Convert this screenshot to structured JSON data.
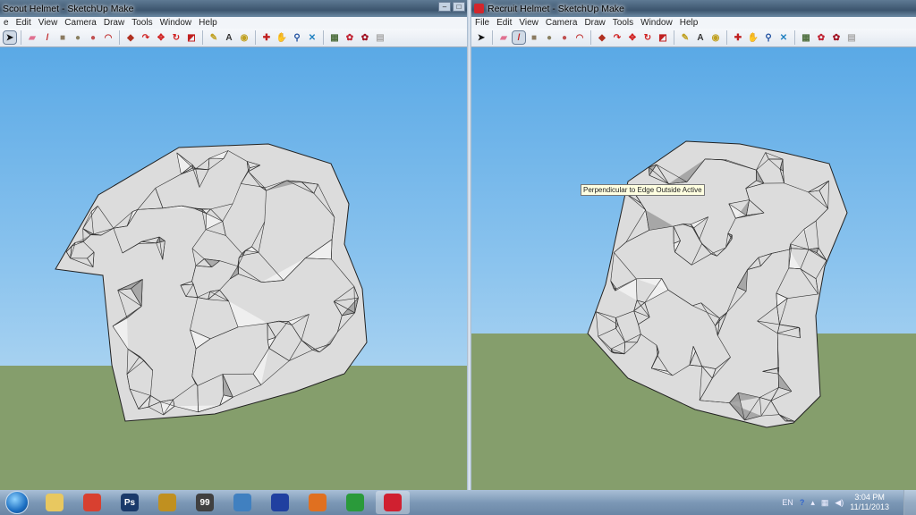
{
  "left_window": {
    "title": "Scout Helmet - SketchUp Make",
    "menu": [
      "e",
      "Edit",
      "View",
      "Camera",
      "Draw",
      "Tools",
      "Window",
      "Help"
    ],
    "selected_tool": "select"
  },
  "right_window": {
    "title": "Recruit Helmet - SketchUp Make",
    "menu": [
      "File",
      "Edit",
      "View",
      "Camera",
      "Draw",
      "Tools",
      "Window",
      "Help"
    ],
    "selected_tool": "pencil",
    "tooltip": "Perpendicular to Edge Outside Active"
  },
  "toolbar": [
    {
      "icon": "select-icon",
      "g": "➤",
      "c": "#111"
    },
    {
      "sep": true
    },
    {
      "icon": "eraser-icon",
      "g": "▰",
      "c": "#e07090"
    },
    {
      "icon": "pencil-icon",
      "g": "/",
      "c": "#c02020"
    },
    {
      "icon": "rectangle-icon",
      "g": "■",
      "c": "#8a7a60"
    },
    {
      "icon": "circle-icon",
      "g": "●",
      "c": "#8a8060"
    },
    {
      "icon": "polygon-icon",
      "g": "●",
      "c": "#c05050"
    },
    {
      "icon": "arc-icon",
      "g": "◠",
      "c": "#c03030"
    },
    {
      "sep": true
    },
    {
      "icon": "push-pull-icon",
      "g": "◆",
      "c": "#b03020"
    },
    {
      "icon": "follow-me-icon",
      "g": "↷",
      "c": "#d02020"
    },
    {
      "icon": "move-icon",
      "g": "✥",
      "c": "#d02020"
    },
    {
      "icon": "rotate-icon",
      "g": "↻",
      "c": "#d02020"
    },
    {
      "icon": "scale-icon",
      "g": "◩",
      "c": "#c02020"
    },
    {
      "sep": true
    },
    {
      "icon": "tape-measure-icon",
      "g": "✎",
      "c": "#c0a020"
    },
    {
      "icon": "text-icon",
      "g": "A",
      "c": "#333"
    },
    {
      "icon": "paint-bucket-icon",
      "g": "◉",
      "c": "#c0a020"
    },
    {
      "sep": true
    },
    {
      "icon": "orbit-icon",
      "g": "✚",
      "c": "#c02020"
    },
    {
      "icon": "pan-icon",
      "g": "✋",
      "c": "#888"
    },
    {
      "icon": "zoom-icon",
      "g": "⚲",
      "c": "#2050a0"
    },
    {
      "icon": "zoom-extents-icon",
      "g": "✕",
      "c": "#2080c0"
    },
    {
      "sep": true
    },
    {
      "icon": "get-models-icon",
      "g": "▦",
      "c": "#507040"
    },
    {
      "icon": "share-model-icon",
      "g": "✿",
      "c": "#c02030"
    },
    {
      "icon": "extension-warehouse-icon",
      "g": "✿",
      "c": "#a01020"
    },
    {
      "icon": "layout-icon",
      "g": "▤",
      "c": "#aaa"
    }
  ],
  "taskbar": {
    "items": [
      {
        "icon": "explorer-icon",
        "label": "",
        "c": "#e8c860"
      },
      {
        "icon": "chrome-icon",
        "label": "",
        "c": "#d84030"
      },
      {
        "icon": "photoshop-icon",
        "label": "Ps",
        "c": "#1a3a6a"
      },
      {
        "icon": "fl-studio-icon",
        "label": "",
        "c": "#c09020"
      },
      {
        "icon": "fraps-icon",
        "label": "99",
        "c": "#404040"
      },
      {
        "icon": "sketchup-app-icon",
        "label": "",
        "c": "#4080c0"
      },
      {
        "icon": "audacity-icon",
        "label": "",
        "c": "#2040a0"
      },
      {
        "icon": "blender-icon",
        "label": "",
        "c": "#e07020"
      },
      {
        "icon": "utorrent-icon",
        "label": "",
        "c": "#2a9a3a"
      },
      {
        "icon": "sketchup-icon",
        "label": "",
        "c": "#d02030"
      }
    ],
    "tray": {
      "lang": "EN",
      "time": "3:04 PM",
      "date": "11/11/2013"
    }
  }
}
